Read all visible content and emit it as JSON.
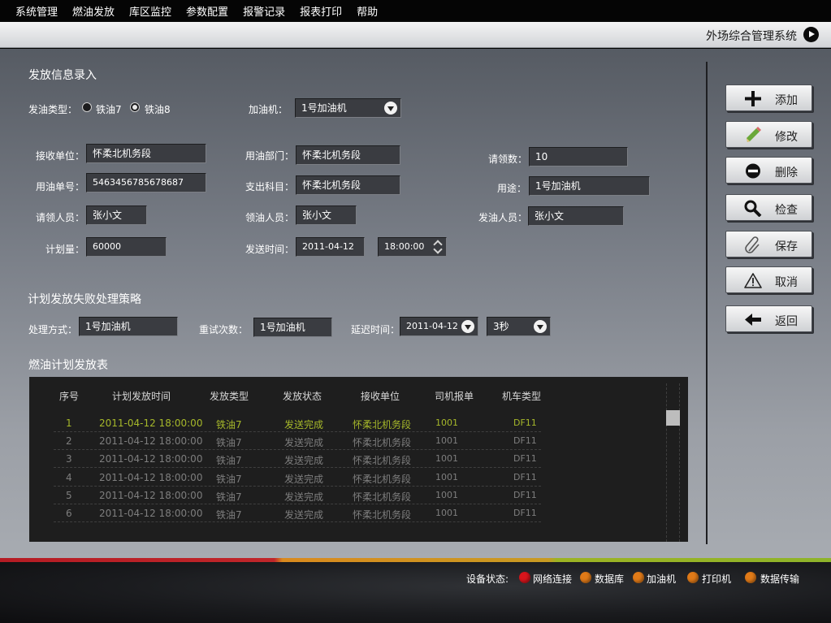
{
  "menu": [
    "系统管理",
    "燃油发放",
    "库区监控",
    "参数配置",
    "报警记录",
    "报表打印",
    "帮助"
  ],
  "app_title": "外场综合管理系统",
  "section_entry": "发放信息录入",
  "fuel_type": {
    "label": "发油类型：",
    "options": [
      "铁油7",
      "铁油8"
    ],
    "selected": "铁油8"
  },
  "dispenser": {
    "label": "加油机：",
    "value": "1号加油机"
  },
  "form": {
    "receive_unit": {
      "label": "接收单位：",
      "value": "怀柔北机务段"
    },
    "oil_dept": {
      "label": "用油部门：",
      "value": "怀柔北机务段"
    },
    "request_count": {
      "label": "请领数：",
      "value": "10"
    },
    "oil_no": {
      "label": "用油单号：",
      "value": "5463456785678687"
    },
    "expense_item": {
      "label": "支出科目：",
      "value": "怀柔北机务段"
    },
    "purpose": {
      "label": "用途：",
      "value": "1号加油机"
    },
    "requester": {
      "label": "请领人员：",
      "value": "张小文"
    },
    "receiver": {
      "label": "领油人员：",
      "value": "张小文"
    },
    "issuer": {
      "label": "发油人员：",
      "value": "张小文"
    },
    "plan_amount": {
      "label": "计划量：",
      "value": "60000"
    },
    "send_time": {
      "label": "发送时间：",
      "date": "2011-04-12",
      "time": "18:00:00"
    }
  },
  "section_fail": "计划发放失败处理策略",
  "fail": {
    "method": {
      "label": "处理方式：",
      "value": "1号加油机"
    },
    "retry": {
      "label": "重试次数：",
      "value": "1号加油机"
    },
    "delay": {
      "label": "延迟时间：",
      "date": "2011-04-12",
      "seconds": "3秒"
    }
  },
  "section_table": "燃油计划发放表",
  "table": {
    "headers": [
      "序号",
      "计划发放时间",
      "发放类型",
      "发放状态",
      "接收单位",
      "司机报单",
      "机车类型"
    ],
    "rows": [
      [
        "1",
        "2011-04-12 18:00:00",
        "铁油7",
        "发送完成",
        "怀柔北机务段",
        "1001",
        "DF11"
      ],
      [
        "2",
        "2011-04-12 18:00:00",
        "铁油7",
        "发送完成",
        "怀柔北机务段",
        "1001",
        "DF11"
      ],
      [
        "3",
        "2011-04-12 18:00:00",
        "铁油7",
        "发送完成",
        "怀柔北机务段",
        "1001",
        "DF11"
      ],
      [
        "4",
        "2011-04-12 18:00:00",
        "铁油7",
        "发送完成",
        "怀柔北机务段",
        "1001",
        "DF11"
      ],
      [
        "5",
        "2011-04-12 18:00:00",
        "铁油7",
        "发送完成",
        "怀柔北机务段",
        "1001",
        "DF11"
      ],
      [
        "6",
        "2011-04-12 18:00:00",
        "铁油7",
        "发送完成",
        "怀柔北机务段",
        "1001",
        "DF11"
      ]
    ]
  },
  "buttons": {
    "add": "添加",
    "edit": "修改",
    "delete": "删除",
    "check": "检查",
    "save": "保存",
    "cancel": "取消",
    "back": "返回"
  },
  "status": {
    "label": "设备状态:",
    "items": [
      {
        "name": "网络连接",
        "color": "#d8151c"
      },
      {
        "name": "数据库",
        "color": "#e07a18"
      },
      {
        "name": "加油机",
        "color": "#e07a18"
      },
      {
        "name": "打印机",
        "color": "#e07a18"
      },
      {
        "name": "数据传输",
        "color": "#e07a18"
      }
    ]
  },
  "colors": {
    "accent_green": "#a6b82a",
    "status_red": "#d8151c",
    "status_orange": "#e07a18"
  }
}
